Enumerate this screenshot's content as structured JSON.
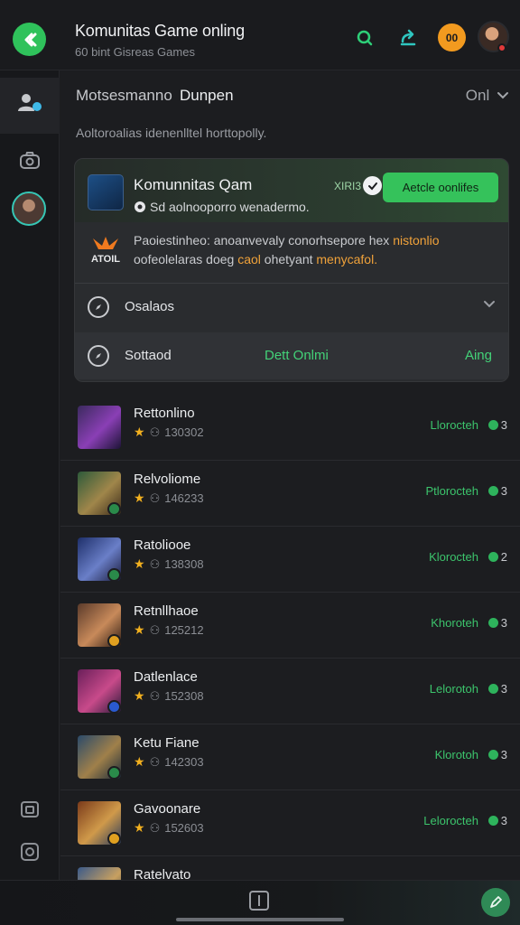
{
  "header": {
    "title": "Komunitas Game onling",
    "subtitle": "60 bint Gisreas Games",
    "orange_badge": "00"
  },
  "filters": {
    "tab1": "Motsesmanno",
    "tab2": "Dunpen",
    "online": "Onl"
  },
  "caption": "Aoltoroalias idenenlltel horttopolly.",
  "featured": {
    "title": "Komunnitas Qam",
    "subtitle": "Sd aolnooporro wenadermo.",
    "count": "XIRI3",
    "join_label": "Aetcle oonlifes",
    "logo_text": "ATOIL",
    "desc_plain1": "Paoiestinheo: anoanvevaly conorhsepore hex ",
    "desc_hl1": "nistonlio",
    "desc_plain2": "oofeolelaras doeg ",
    "desc_hl2": "caol",
    "desc_plain3": "ohetyant ",
    "desc_hl3": "menycafol.",
    "row1_label": "Osalaos",
    "row2_label": "Sottaod",
    "row2_mid": "Dett Onlmi",
    "row2_right": "Aing"
  },
  "list": [
    {
      "name": "Rettonlino",
      "rating": "130302",
      "status": "Llorocteh",
      "count": "3"
    },
    {
      "name": "Relvoliome",
      "rating": "146233",
      "status": "Ptlorocteh",
      "count": "3"
    },
    {
      "name": "Ratoliooe",
      "rating": "138308",
      "status": "Klorocteh",
      "count": "2"
    },
    {
      "name": "Retnllhaoe",
      "rating": "125212",
      "status": "Khoroteh",
      "count": "3"
    },
    {
      "name": "Datlenlace",
      "rating": "152308",
      "status": "Lelorotoh",
      "count": "3"
    },
    {
      "name": "Ketu Fiane",
      "rating": "142303",
      "status": "Klorotoh",
      "count": "3"
    },
    {
      "name": "Gavoonare",
      "rating": "152603",
      "status": "Lelorocteh",
      "count": "3"
    },
    {
      "name": "Ratelvato",
      "rating": "",
      "status": "",
      "count": ""
    }
  ],
  "colors": {
    "accent_green": "#35c25b",
    "highlight_orange": "#f0a23a",
    "star_yellow": "#f2b01f"
  }
}
